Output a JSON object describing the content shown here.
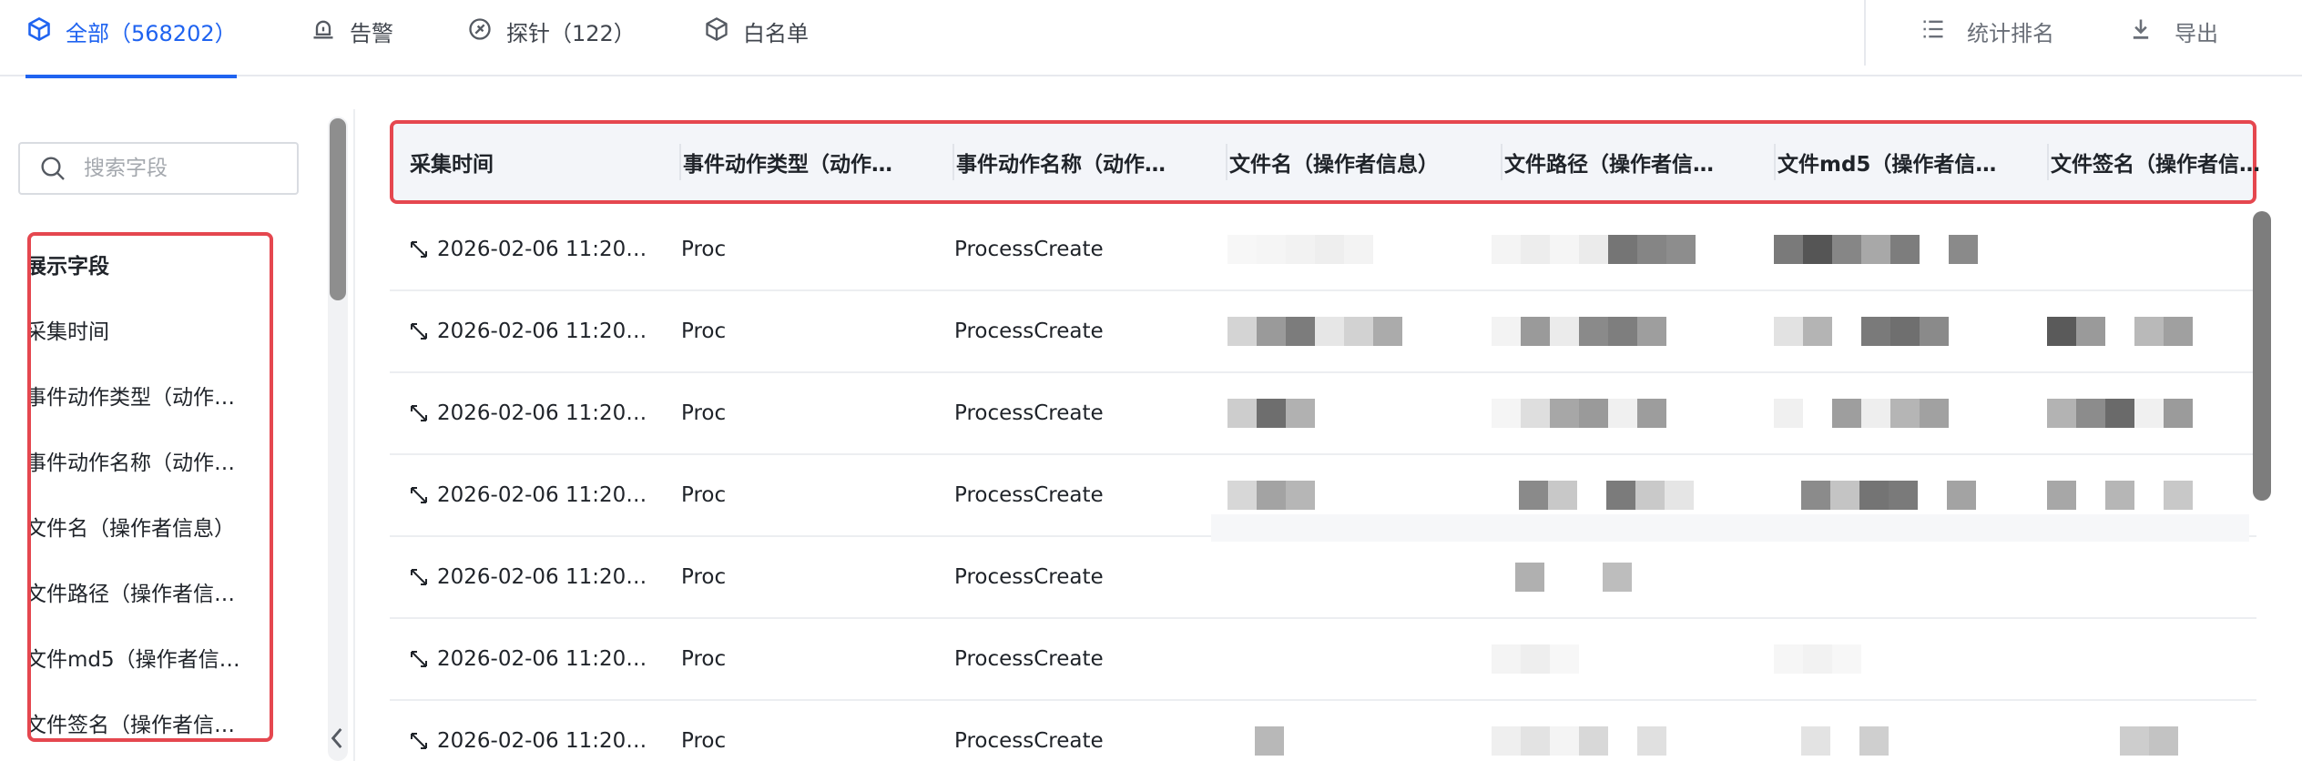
{
  "tabs": [
    {
      "label": "全部（568202）",
      "icon": "cube-icon",
      "active": true
    },
    {
      "label": "告警",
      "icon": "alarm-icon"
    },
    {
      "label": "探针（122）",
      "icon": "probe-icon"
    },
    {
      "label": "白名单",
      "icon": "cube-outline-icon"
    }
  ],
  "tools": [
    {
      "label": "统计排名",
      "icon": "list-icon"
    },
    {
      "label": "导出",
      "icon": "download-icon"
    }
  ],
  "search": {
    "placeholder": "搜索字段"
  },
  "fields": {
    "header": "展示字段",
    "items": [
      "采集时间",
      "事件动作类型（动作…",
      "事件动作名称（动作…",
      "文件名（操作者信息）",
      "文件路径（操作者信…",
      "文件md5（操作者信…",
      "文件签名（操作者信…"
    ]
  },
  "table": {
    "columns": [
      "采集时间",
      "事件动作类型（动作…",
      "事件动作名称（动作…",
      "文件名（操作者信息）",
      "文件路径（操作者信…",
      "文件md5（操作者信…",
      "文件签名（操作者信…"
    ],
    "rows": [
      {
        "time": "2026-02-06 11:20…",
        "type": "Proc",
        "name": "ProcessCreate"
      },
      {
        "time": "2026-02-06 11:20…",
        "type": "Proc",
        "name": "ProcessCreate"
      },
      {
        "time": "2026-02-06 11:20…",
        "type": "Proc",
        "name": "ProcessCreate"
      },
      {
        "time": "2026-02-06 11:20…",
        "type": "Proc",
        "name": "ProcessCreate"
      },
      {
        "time": "2026-02-06 11:20…",
        "type": "Proc",
        "name": "ProcessCreate"
      },
      {
        "time": "2026-02-06 11:20…",
        "type": "Proc",
        "name": "ProcessCreate"
      },
      {
        "time": "2026-02-06 11:20…",
        "type": "Proc",
        "name": "ProcessCreate"
      }
    ]
  },
  "colors": {
    "accent": "#1f63f0",
    "highlight": "#e5474f"
  }
}
